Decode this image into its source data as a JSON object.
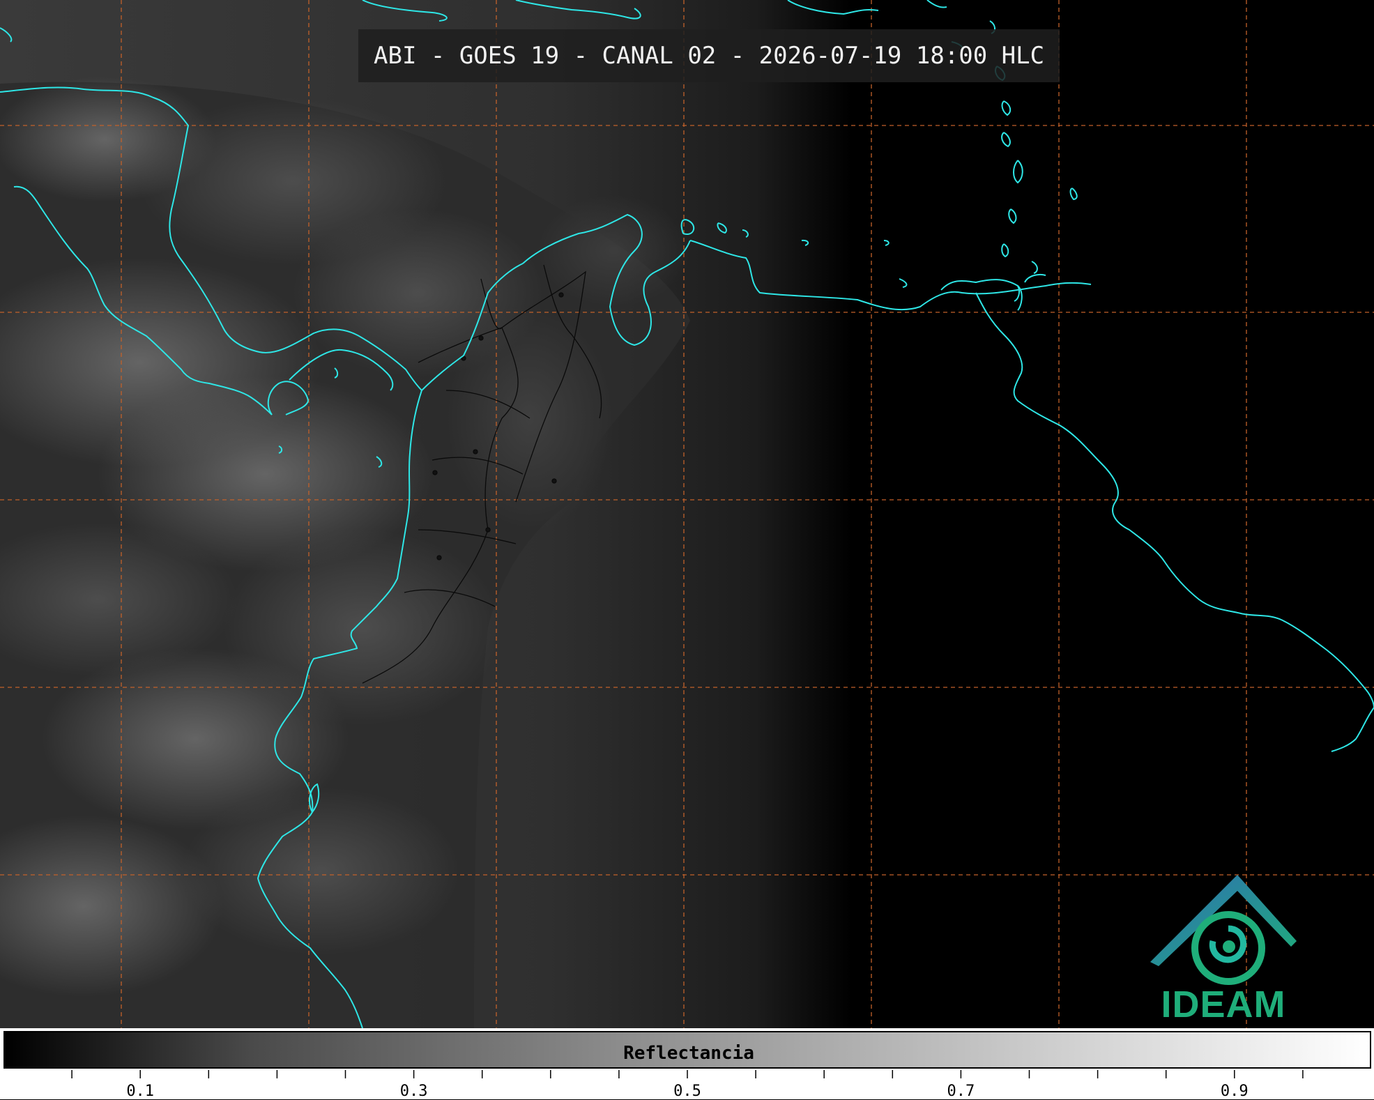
{
  "title": "ABI - GOES 19 - CANAL 02 - 2026-07-19 18:00 HLC",
  "colorbar": {
    "label": "Reflectancia",
    "min": 0.0,
    "max": 1.0,
    "labeled_ticks": [
      "0.1",
      "0.3",
      "0.5",
      "0.7",
      "0.9"
    ],
    "tick_step": 0.05
  },
  "logo": {
    "text": "IDEAM"
  },
  "colors": {
    "coastline": "#2ee6e6",
    "gridline": "#c2612a",
    "borders": "#000000",
    "logo_blue": "#2f6fb3",
    "logo_green": "#1fae7a"
  },
  "map": {
    "gridlines": "dashed",
    "imagery": "visible reflectance, grayscale"
  }
}
